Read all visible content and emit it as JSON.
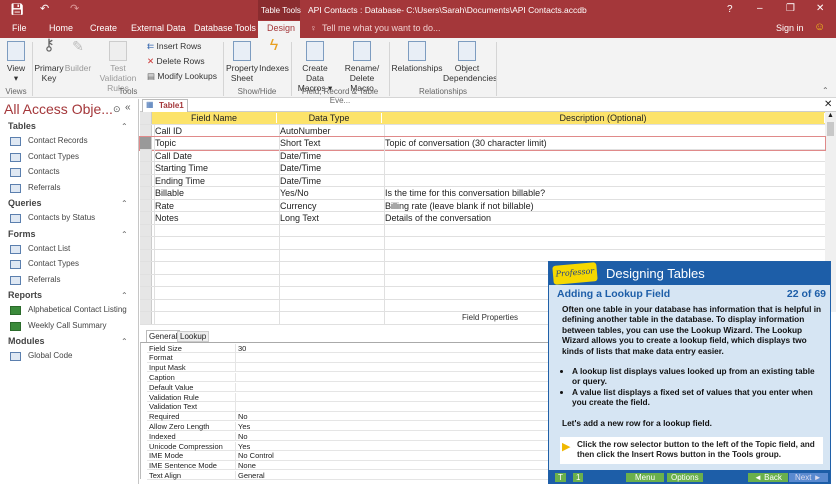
{
  "titlebar": {
    "context_tab": "Table Tools",
    "title": "API Contacts : Database- C:\\Users\\Sarah\\Documents\\API Contacts.accdb",
    "help": "?",
    "minimize": "–",
    "restore": "❐",
    "close": "✕"
  },
  "tabs": {
    "file": "File",
    "home": "Home",
    "create": "Create",
    "external": "External Data",
    "dbtools": "Database Tools",
    "design": "Design",
    "tellme": "Tell me what you want to do...",
    "signin": "Sign in"
  },
  "ribbon": {
    "view": "View",
    "primary_key": "Primary Key",
    "builder": "Builder",
    "test_validation": "Test Validation Rules",
    "insert_rows": "Insert Rows",
    "delete_rows": "Delete Rows",
    "modify_lookups": "Modify Lookups",
    "property_sheet": "Property Sheet",
    "indexes": "Indexes",
    "create_data_macros": "Create Data Macros",
    "rename_delete_macro": "Rename/ Delete Macro",
    "relationships": "Relationships",
    "object_dependencies": "Object Dependencies",
    "groups": {
      "views": "Views",
      "tools": "Tools",
      "showhide": "Show/Hide",
      "field_events": "Field, Record & Table Eve...",
      "relationships": "Relationships"
    }
  },
  "nav": {
    "title": "All Access Obje...",
    "sections": [
      {
        "label": "Tables",
        "items": [
          "Contact Records",
          "Contact Types",
          "Contacts",
          "Referrals"
        ]
      },
      {
        "label": "Queries",
        "items": [
          "Contacts by Status"
        ]
      },
      {
        "label": "Forms",
        "items": [
          "Contact List",
          "Contact Types",
          "Referrals"
        ]
      },
      {
        "label": "Reports",
        "items": [
          "Alphabetical Contact Listing",
          "Weekly Call Summary"
        ]
      },
      {
        "label": "Modules",
        "items": [
          "Global Code"
        ]
      }
    ]
  },
  "doc_tab": "Table1",
  "grid": {
    "headers": [
      "Field Name",
      "Data Type",
      "Description (Optional)"
    ],
    "rows": [
      [
        "Call ID",
        "AutoNumber",
        ""
      ],
      [
        "Topic",
        "Short Text",
        "Topic of conversation (30 character limit)"
      ],
      [
        "Call Date",
        "Date/Time",
        ""
      ],
      [
        "Starting Time",
        "Date/Time",
        ""
      ],
      [
        "Ending Time",
        "Date/Time",
        ""
      ],
      [
        "Billable",
        "Yes/No",
        "Is the time for this conversation billable?"
      ],
      [
        "Rate",
        "Currency",
        "Billing rate (leave blank if not billable)"
      ],
      [
        "Notes",
        "Long Text",
        "Details of the conversation"
      ]
    ]
  },
  "field_properties": {
    "label": "Field Properties",
    "tabs": [
      "General",
      "Lookup"
    ],
    "rows": [
      [
        "Field Size",
        "30"
      ],
      [
        "Format",
        ""
      ],
      [
        "Input Mask",
        ""
      ],
      [
        "Caption",
        ""
      ],
      [
        "Default Value",
        ""
      ],
      [
        "Validation Rule",
        ""
      ],
      [
        "Validation Text",
        ""
      ],
      [
        "Required",
        "No"
      ],
      [
        "Allow Zero Length",
        "Yes"
      ],
      [
        "Indexed",
        "No"
      ],
      [
        "Unicode Compression",
        "Yes"
      ],
      [
        "IME Mode",
        "No Control"
      ],
      [
        "IME Sentence Mode",
        "None"
      ],
      [
        "Text Align",
        "General"
      ]
    ]
  },
  "tutor": {
    "logo": "Professor Teaches",
    "title": "Designing Tables",
    "lesson": "Adding a Lookup Field",
    "progress": "22 of 69",
    "intro": "Often one table in your database has information that is helpful in defining another table in the database. To display information between tables, you can use the Lookup Wizard. The Lookup Wizard allows you to create a lookup field, which displays two kinds of lists that make data entry easier.",
    "bullets": [
      "A lookup list displays values looked up from an existing table or query.",
      "A value list displays a fixed set of values that you enter when you create the field."
    ],
    "prompt": "Let's add a new row for a lookup field.",
    "instruction": "Click the row selector button to the left of the Topic field, and then click the Insert Rows button in the Tools group.",
    "buttons": {
      "t": "T",
      "one": "1",
      "menu": "Menu",
      "options": "Options",
      "back": "◄ Back",
      "next": "Next ►"
    }
  },
  "colors": {
    "accent": "#a4373a",
    "header": "#fce36a",
    "tutor_blue": "#1d5ea8"
  }
}
